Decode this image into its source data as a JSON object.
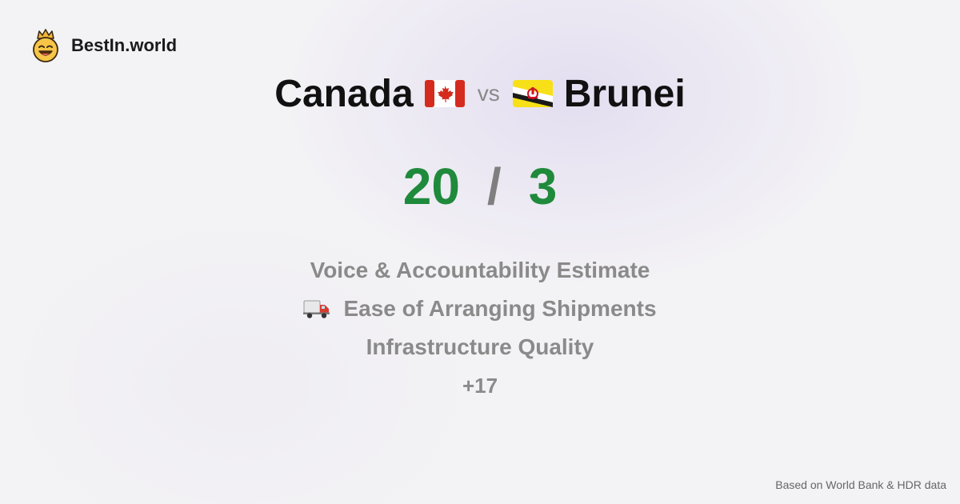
{
  "brand": {
    "name": "BestIn.world",
    "logo_icon": "crowned-smiley-icon"
  },
  "comparison": {
    "left_country": "Canada",
    "left_flag": "canada-flag-icon",
    "vs_label": "vs",
    "right_country": "Brunei",
    "right_flag": "brunei-flag-icon"
  },
  "scores": {
    "left": "20",
    "separator": "/",
    "right": "3",
    "color": "#1f8a3b"
  },
  "metrics": [
    {
      "label": "Voice & Accountability Estimate"
    },
    {
      "label": "Ease of Arranging Shipments",
      "icon": "delivery-truck-icon"
    },
    {
      "label": "Infrastructure Quality"
    }
  ],
  "more_count": "+17",
  "footer": {
    "source": "Based on World Bank & HDR data"
  }
}
